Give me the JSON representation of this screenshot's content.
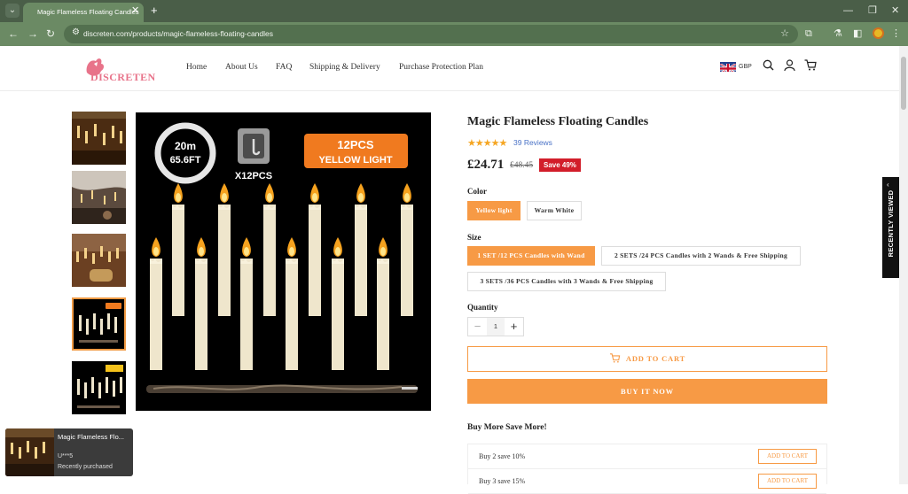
{
  "browser": {
    "tab_title": "Magic Flameless Floating Candles",
    "url": "discreten.com/products/magic-flameless-floating-candles"
  },
  "header": {
    "logo_text": "DISCRETEN",
    "nav": [
      "Home",
      "About Us",
      "FAQ",
      "Shipping & Delivery",
      "Purchase Protection Plan"
    ],
    "currency": "GBP"
  },
  "gallery": {
    "banner_length": "20m\n65.6FT",
    "banner_hooks": "X12PCS",
    "banner_count": "12PCS",
    "banner_light": "YELLOW LIGHT",
    "active_thumb_index": 3
  },
  "product": {
    "title": "Magic Flameless Floating Candles",
    "rating": 5,
    "reviews": "39 Reviews",
    "price": "£24.71",
    "old_price": "£48.45",
    "save_badge": "Save 49%",
    "color_label": "Color",
    "colors": [
      "Yellow light",
      "Warm White"
    ],
    "selected_color": "Yellow light",
    "size_label": "Size",
    "sizes": [
      "1 SET /12 PCS Candles with Wand",
      "2 SETS /24 PCS Candles with 2 Wands & Free Shipping",
      "3 SETS /36 PCS Candles with 3 Wands & Free Shipping"
    ],
    "selected_size": "1 SET /12 PCS Candles with Wand",
    "quantity_label": "Quantity",
    "quantity": "1",
    "add_to_cart": "ADD TO CART",
    "buy_now": "BUY IT NOW"
  },
  "bundles": {
    "title": "Buy More Save More!",
    "rows": [
      {
        "label": "Buy 2 save 10%",
        "button": "ADD TO CART"
      },
      {
        "label": "Buy 3 save 15%",
        "button": "ADD TO CART"
      }
    ]
  },
  "recently_viewed": "RECENTLY VIEWED",
  "popup": {
    "title": "Magic Flameless Flo...",
    "user": "U***5",
    "status": "Recently purchased"
  },
  "colors": {
    "accent": "#f79a45",
    "save_red": "#d21d2a",
    "chrome": "#6b8a64"
  }
}
